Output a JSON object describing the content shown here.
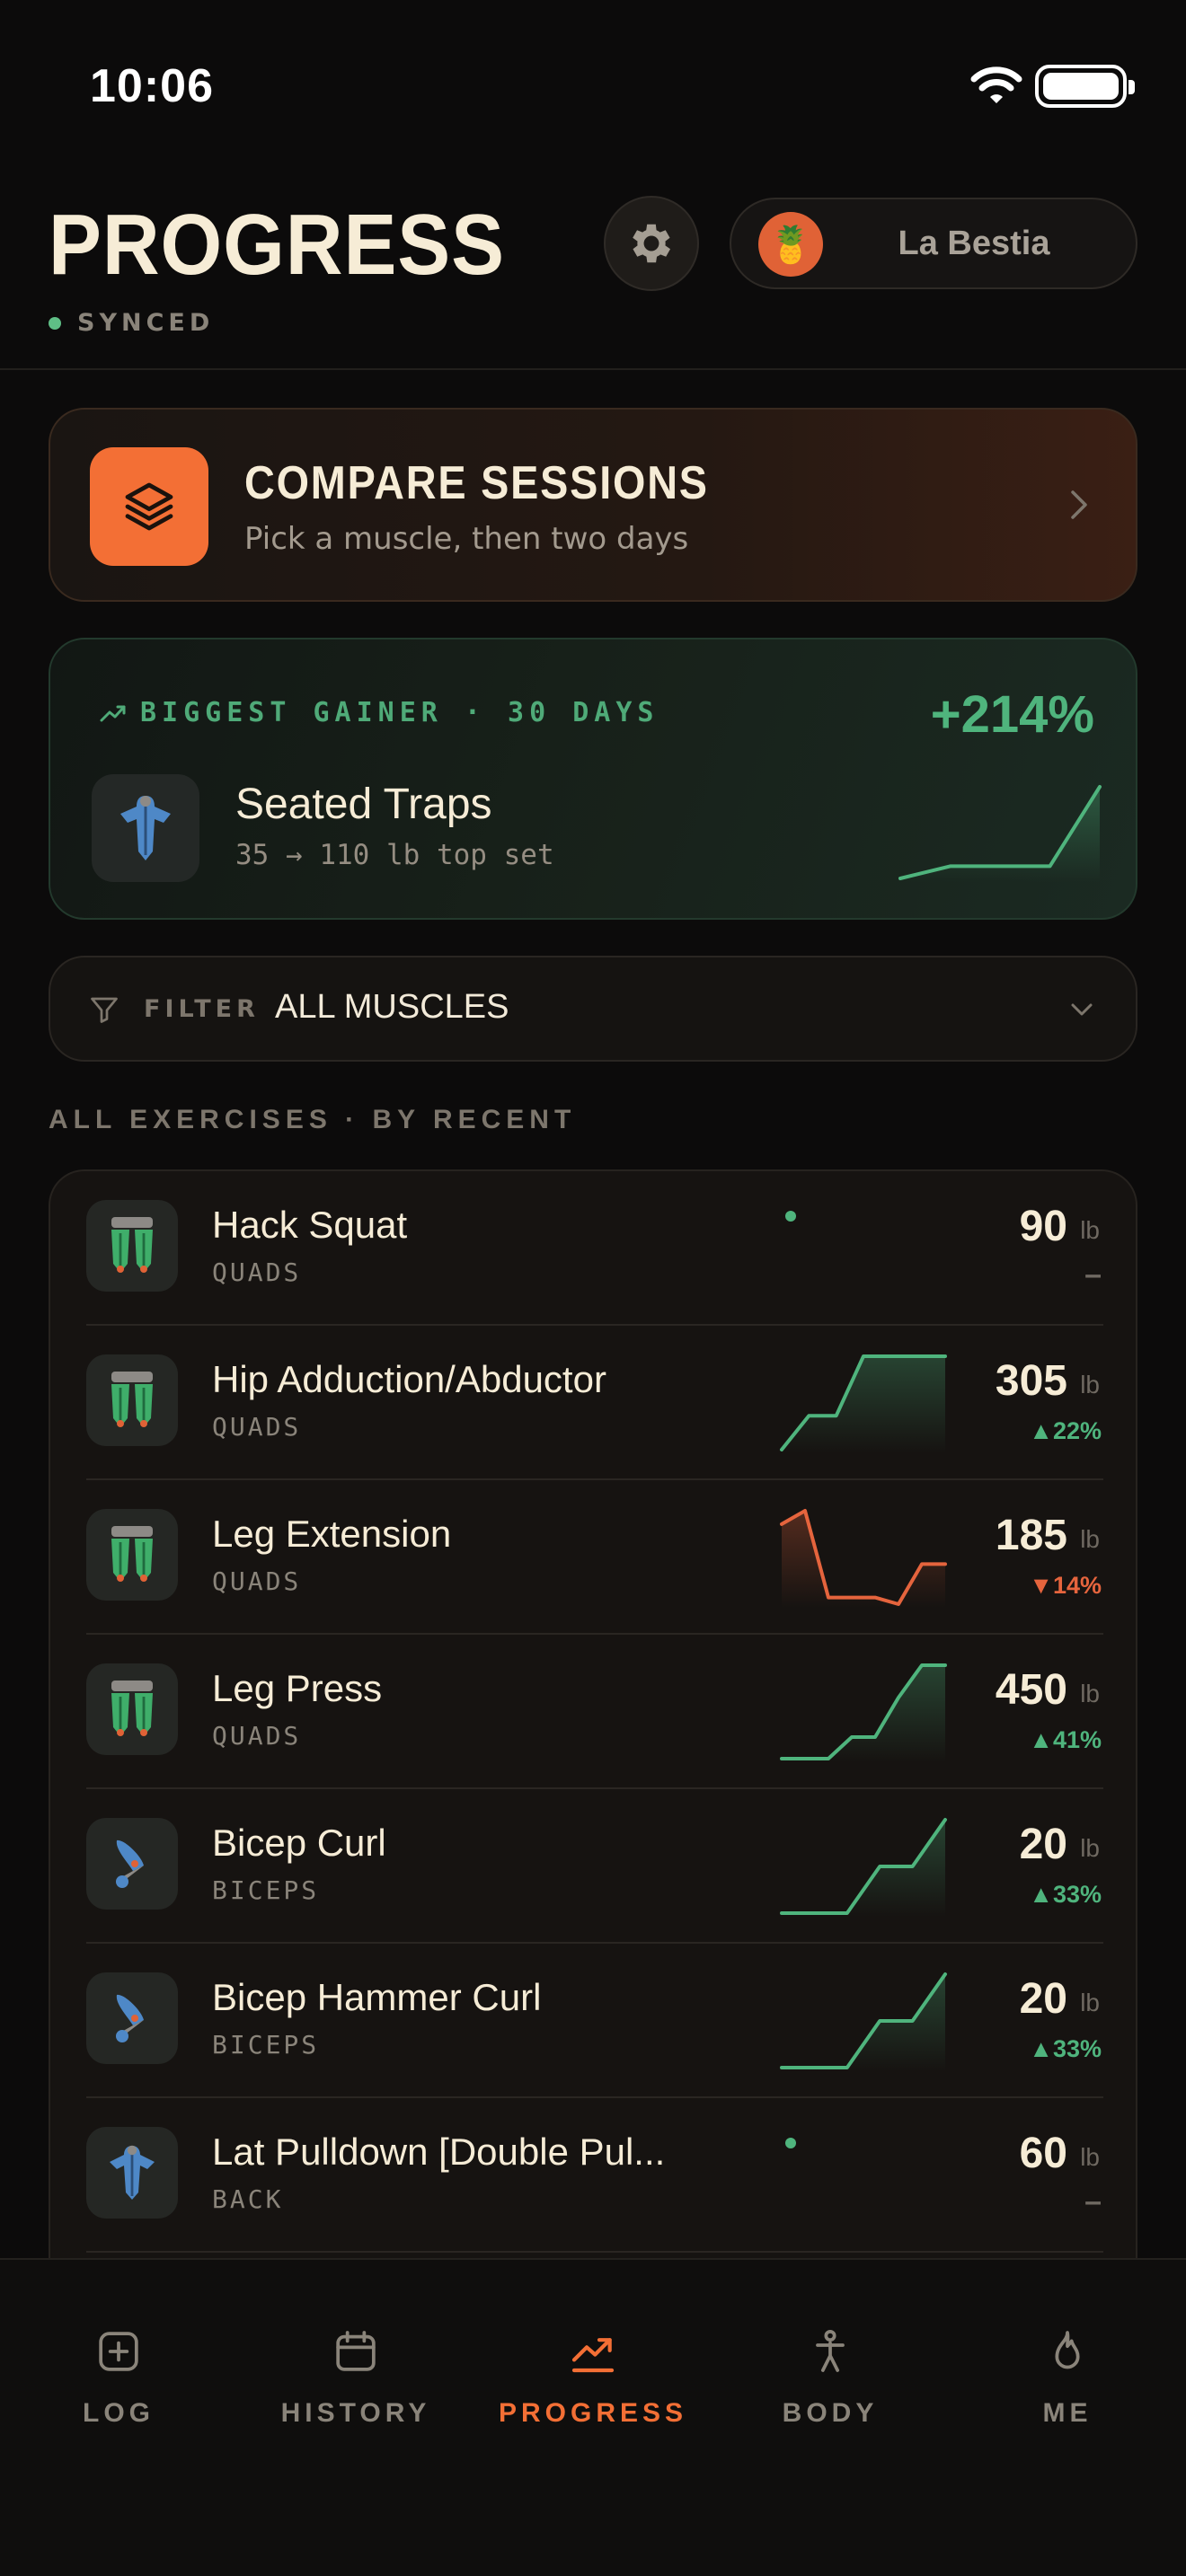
{
  "status_bar": {
    "time": "10:06"
  },
  "header": {
    "title": "PROGRESS",
    "sync_status": "SYNCED",
    "profile_name": "La Bestia",
    "avatar_emoji": "🍍"
  },
  "compare": {
    "title": "COMPARE SESSIONS",
    "subtitle": "Pick a muscle, then two days"
  },
  "gainer": {
    "label": "BIGGEST GAINER · 30 DAYS",
    "percent": "+214%",
    "exercise": "Seated Traps",
    "detail": "35 → 110 lb top set",
    "trend": [
      35,
      45,
      45,
      45,
      110
    ]
  },
  "filter": {
    "label": "FILTER",
    "value": "ALL MUSCLES"
  },
  "section_heading": "ALL EXERCISES  ·  BY RECENT",
  "exercises": [
    {
      "name": "Hack Squat",
      "muscle": "QUADS",
      "value": "90",
      "unit": "lb",
      "change": "–",
      "direction": "flat",
      "icon": "quads-icon",
      "trend": [
        90
      ]
    },
    {
      "name": "Hip Adduction/Abductor",
      "muscle": "QUADS",
      "value": "305",
      "unit": "lb",
      "change": "▲22%",
      "direction": "up",
      "icon": "quads-icon",
      "trend": [
        250,
        270,
        270,
        305,
        305,
        305,
        305
      ]
    },
    {
      "name": "Leg Extension",
      "muscle": "QUADS",
      "value": "185",
      "unit": "lb",
      "change": "▼14%",
      "direction": "down",
      "icon": "quads-icon",
      "trend": [
        215,
        225,
        160,
        160,
        160,
        155,
        185,
        185
      ]
    },
    {
      "name": "Leg Press",
      "muscle": "QUADS",
      "value": "450",
      "unit": "lb",
      "change": "▲41%",
      "direction": "up",
      "icon": "quads-icon",
      "trend": [
        320,
        320,
        320,
        350,
        350,
        405,
        450,
        450
      ]
    },
    {
      "name": "Bicep Curl",
      "muscle": "BICEPS",
      "value": "20",
      "unit": "lb",
      "change": "▲33%",
      "direction": "up",
      "icon": "biceps-icon",
      "trend": [
        15,
        15,
        15,
        17.5,
        17.5,
        20
      ]
    },
    {
      "name": "Bicep Hammer Curl",
      "muscle": "BICEPS",
      "value": "20",
      "unit": "lb",
      "change": "▲33%",
      "direction": "up",
      "icon": "biceps-icon",
      "trend": [
        15,
        15,
        15,
        17.5,
        17.5,
        20
      ]
    },
    {
      "name": "Lat Pulldown [Double Pul...",
      "muscle": "BACK",
      "value": "60",
      "unit": "lb",
      "change": "–",
      "direction": "flat",
      "icon": "back-icon",
      "trend": [
        60
      ]
    }
  ],
  "tabs": [
    {
      "label": "LOG",
      "icon": "plus-square-icon",
      "active": false
    },
    {
      "label": "HISTORY",
      "icon": "calendar-icon",
      "active": false
    },
    {
      "label": "PROGRESS",
      "icon": "trend-up-icon",
      "active": true
    },
    {
      "label": "BODY",
      "icon": "body-icon",
      "active": false
    },
    {
      "label": "ME",
      "icon": "flame-icon",
      "active": false
    }
  ],
  "colors": {
    "accent": "#f36f35",
    "positive": "#4fb47d",
    "negative": "#e5643d",
    "background": "#0c0b0b"
  }
}
